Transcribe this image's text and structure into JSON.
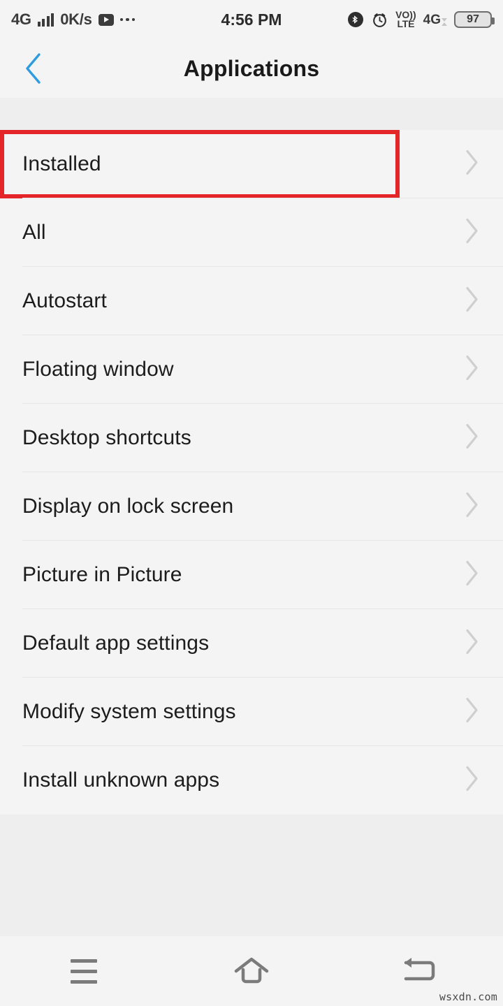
{
  "statusbar": {
    "network_label": "4G",
    "data_rate": "0K/s",
    "signal_icon": "signal-bars-icon",
    "video_icon": "video-play-icon",
    "overflow_icon": "more-dots-icon",
    "clock": "4:56 PM",
    "bluetooth_icon": "bluetooth-icon",
    "alarm_icon": "alarm-clock-icon",
    "volte_line1": "VO))",
    "volte_line2": "LTE",
    "mobile_network": "4G",
    "battery_percent": "97"
  },
  "header": {
    "title": "Applications",
    "back_icon": "chevron-left-icon",
    "back_color": "#2f9be0"
  },
  "list": {
    "chevron_icon": "chevron-right-icon",
    "highlight_color": "#e4252a",
    "items": [
      {
        "label": "Installed",
        "highlighted": true
      },
      {
        "label": "All",
        "highlighted": false
      },
      {
        "label": "Autostart",
        "highlighted": false
      },
      {
        "label": "Floating window",
        "highlighted": false
      },
      {
        "label": "Desktop shortcuts",
        "highlighted": false
      },
      {
        "label": "Display on lock screen",
        "highlighted": false
      },
      {
        "label": "Picture in Picture",
        "highlighted": false
      },
      {
        "label": "Default app settings",
        "highlighted": false
      },
      {
        "label": "Modify system settings",
        "highlighted": false
      },
      {
        "label": "Install unknown apps",
        "highlighted": false
      }
    ]
  },
  "navbar": {
    "menu_icon": "menu-hamburger-icon",
    "home_icon": "home-icon",
    "back_icon": "back-arrow-icon"
  },
  "watermark": {
    "text": "wsxdn.com"
  }
}
